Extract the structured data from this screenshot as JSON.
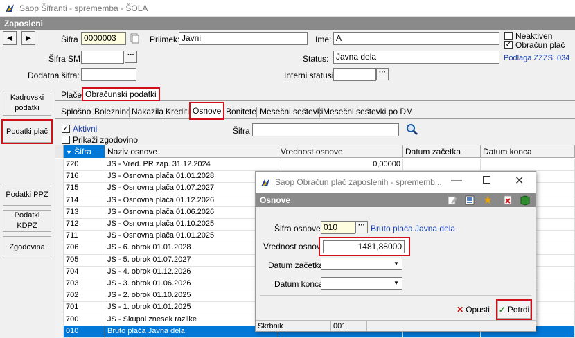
{
  "window": {
    "title": "Saop Šifranti - sprememba - ŠOLA"
  },
  "section": "Zaposleni",
  "fields": {
    "sifra_label": "Šifra",
    "sifra_value": "0000003",
    "priimek_label": "Priimek:",
    "priimek_value": "Javni",
    "ime_label": "Ime:",
    "ime_value": "A",
    "sifra_sm_label": "Šifra SM",
    "sifra_sm_value": "",
    "status_label": "Status:",
    "status_value": "Javna dela",
    "dodatna_label": "Dodatna šifra:",
    "dodatna_value": "",
    "interni_label": "Interni statusi:",
    "interni_value": "",
    "neaktiven_label": "Neaktiven",
    "neaktiven_checked": false,
    "obracun_label": "Obračun plač",
    "obracun_checked": true,
    "podlaga": "Podlaga ZZZS: 034"
  },
  "sidebar": [
    "Kadrovski podatki",
    "Podatki plač",
    "Podatki PPZ",
    "Podatki KDPZ",
    "Zgodovina"
  ],
  "tabs1": [
    "Plače",
    "Obračunski podatki"
  ],
  "tabs2": [
    "Splošno",
    "Boleznine",
    "Nakazila",
    "Krediti",
    "Osnove",
    "Bonitete",
    "Mesečni seštevki",
    "Mesečni seštevki po DM"
  ],
  "filter": {
    "aktivni_label": "Aktivni",
    "aktivni_checked": true,
    "zgodovina_label": "Prikaži zgodovino",
    "zgodovina_checked": false,
    "sifra_label": "Šifra",
    "sifra_value": ""
  },
  "grid": {
    "headers": [
      "Šifra",
      "Naziv osnove",
      "Vrednost osnove",
      "Datum začetka",
      "Datum konca"
    ],
    "rows": [
      [
        "720",
        "JS - Vred. PR zap. 31.12.2024",
        "0,00000",
        "",
        ""
      ],
      [
        "716",
        "JS - Osnovna plača 01.01.2028",
        "",
        "",
        ""
      ],
      [
        "715",
        "JS - Osnovna plača 01.07.2027",
        "",
        "",
        ""
      ],
      [
        "714",
        "JS - Osnovna plača 01.12.2026",
        "",
        "",
        ""
      ],
      [
        "713",
        "JS - Osnovna plača 01.06.2026",
        "",
        "",
        ""
      ],
      [
        "712",
        "JS - Osnovna plača 01.10.2025",
        "",
        "",
        ""
      ],
      [
        "711",
        "JS - Osnovna plača 01.01.2025",
        "",
        "",
        ""
      ],
      [
        "706",
        "JS - 6. obrok 01.01.2028",
        "",
        "",
        ""
      ],
      [
        "705",
        "JS - 5. obrok 01.07.2027",
        "",
        "",
        ""
      ],
      [
        "704",
        "JS - 4. obrok 01.12.2026",
        "",
        "",
        ""
      ],
      [
        "703",
        "JS - 3. obrok 01.06.2026",
        "",
        "",
        ""
      ],
      [
        "702",
        "JS - 2. obrok 01.10.2025",
        "",
        "",
        ""
      ],
      [
        "701",
        "JS - 1. obrok 01.01.2025",
        "",
        "",
        ""
      ],
      [
        "700",
        "JS - Skupni znesek razlike",
        "",
        "",
        ""
      ],
      [
        "010",
        "Bruto plača Javna dela",
        "",
        "",
        ""
      ]
    ]
  },
  "dialog": {
    "title": "Saop Obračun plač zaposlenih - sprememb...",
    "section": "Osnove",
    "sifra_label": "Šifra osnove",
    "sifra_value": "010",
    "sifra_desc": "Bruto plača Javna dela",
    "vrednost_label": "Vrednost osnove",
    "vrednost_value": "1481,88000",
    "zacetek_label": "Datum začetka",
    "konec_label": "Datum konca",
    "opusti": "Opusti",
    "potrdi": "Potrdi",
    "status_label": "Skrbnik",
    "status_value": "001"
  }
}
